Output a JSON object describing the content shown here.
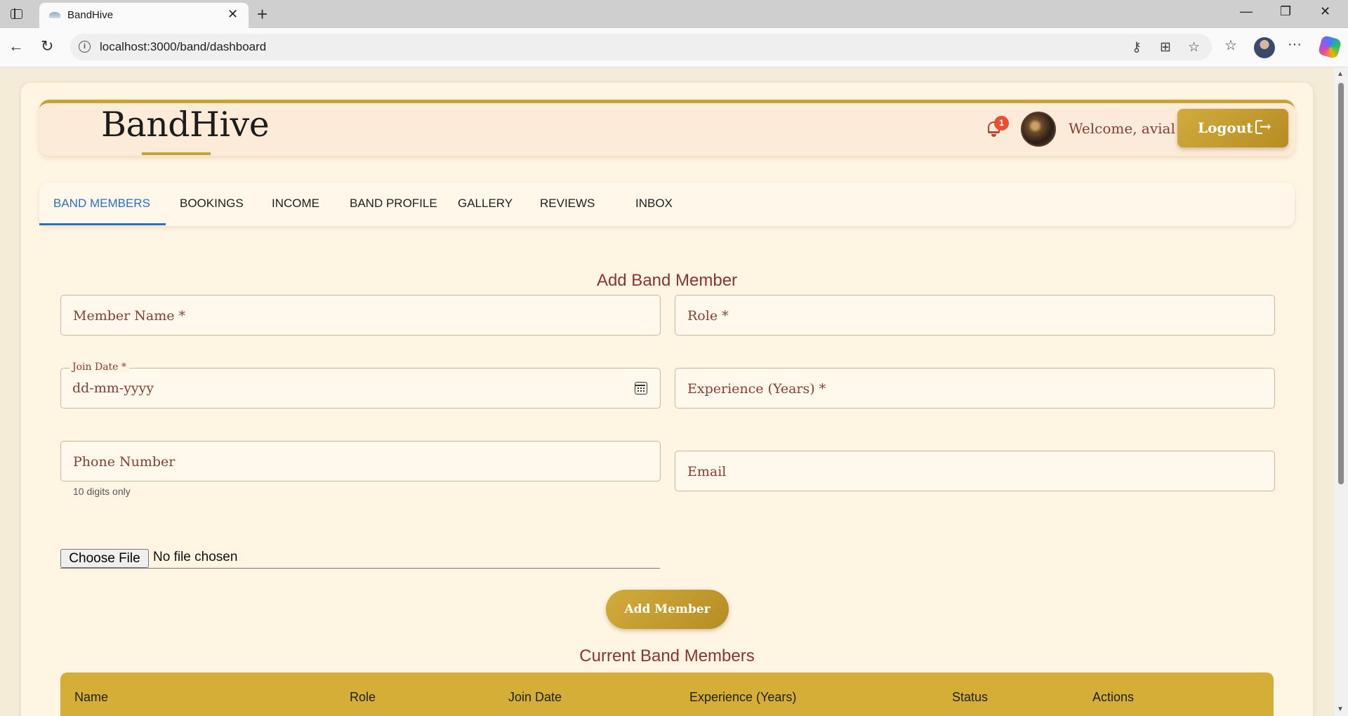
{
  "browser": {
    "tab_title": "BandHive",
    "url": "localhost:3000/band/dashboard"
  },
  "header": {
    "brand": "BandHive",
    "notification_count": "1",
    "welcome": "Welcome, avial",
    "logout_label": "Logout"
  },
  "nav": {
    "tabs": [
      {
        "label": "BAND MEMBERS",
        "active": true
      },
      {
        "label": "BOOKINGS"
      },
      {
        "label": "INCOME"
      },
      {
        "label": "BAND PROFILE"
      },
      {
        "label": "GALLERY"
      },
      {
        "label": "REVIEWS"
      },
      {
        "label": "INBOX"
      }
    ]
  },
  "form": {
    "title": "Add Band Member",
    "member_name_placeholder": "Member Name *",
    "role_placeholder": "Role *",
    "join_date_label": "Join Date *",
    "join_date_value": "dd-mm-yyyy",
    "experience_placeholder": "Experience (Years) *",
    "phone_placeholder": "Phone Number",
    "phone_helper": "10 digits only",
    "email_placeholder": "Email",
    "choose_file_label": "Choose File",
    "no_file_text": "No file chosen",
    "submit_label": "Add Member"
  },
  "members_table": {
    "title": "Current Band Members",
    "columns": [
      "Name",
      "Role",
      "Join Date",
      "Experience (Years)",
      "Status",
      "Actions"
    ]
  },
  "colors": {
    "accent_gold": "#c8a233",
    "text_maroon": "#8a3d33",
    "active_tab_blue": "#2a6fc4",
    "page_background": "#fff5e2"
  }
}
